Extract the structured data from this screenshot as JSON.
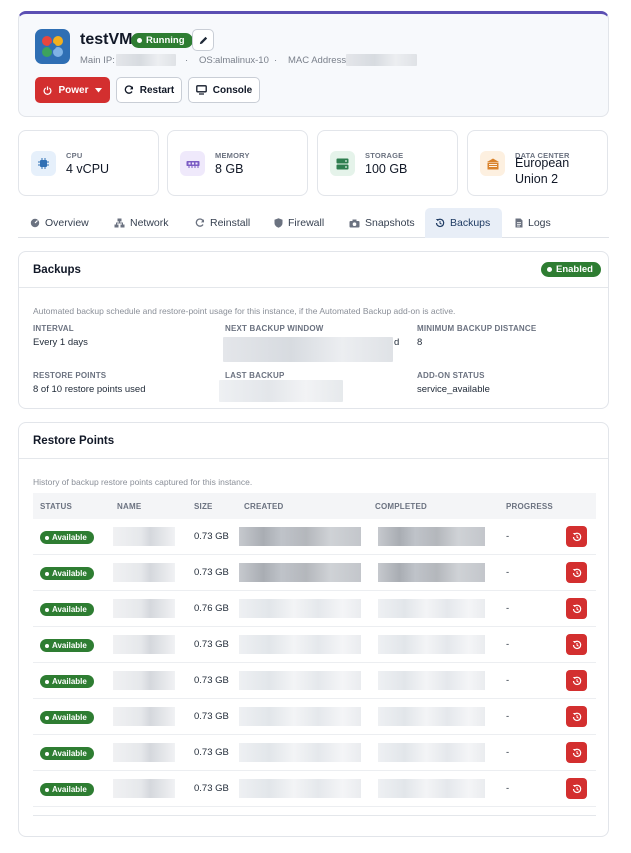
{
  "vm": {
    "name": "testVM",
    "status": "Running",
    "main_ip_label": "Main IP:",
    "os_label": "OS:",
    "os_value": "almalinux-10",
    "mac_label": "MAC Address:",
    "separator": "·"
  },
  "actions": {
    "power": "Power",
    "restart": "Restart",
    "console": "Console"
  },
  "stats": [
    {
      "label": "CPU",
      "value": "4 vCPU",
      "icon": "cpu-icon",
      "color": "#e6f0fb"
    },
    {
      "label": "MEMORY",
      "value": "8 GB",
      "icon": "memory-icon",
      "color": "#efe9fb"
    },
    {
      "label": "STORAGE",
      "value": "100 GB",
      "icon": "storage-icon",
      "color": "#e5f3ea"
    },
    {
      "label": "DATA CENTER",
      "value": "European Union 2",
      "icon": "datacenter-icon",
      "color": "#fdf0e0"
    }
  ],
  "tabs": [
    {
      "label": "Overview",
      "icon": "overview-icon"
    },
    {
      "label": "Network",
      "icon": "network-icon"
    },
    {
      "label": "Reinstall",
      "icon": "reinstall-icon"
    },
    {
      "label": "Firewall",
      "icon": "shield-icon"
    },
    {
      "label": "Snapshots",
      "icon": "camera-icon"
    },
    {
      "label": "Backups",
      "icon": "history-icon",
      "active": true
    },
    {
      "label": "Logs",
      "icon": "document-icon"
    }
  ],
  "backups": {
    "title": "Backups",
    "badge": "Enabled",
    "description": "Automated backup schedule and restore-point usage for this instance, if the Automated Backup add-on is active.",
    "fields": {
      "interval_label": "INTERVAL",
      "interval_value": "Every 1 days",
      "next_label": "NEXT BACKUP WINDOW",
      "next_suffix": "d",
      "min_label": "MINIMUM BACKUP DISTANCE",
      "min_value": "8",
      "restore_label": "RESTORE POINTS",
      "restore_value": "8 of 10 restore points used",
      "last_label": "LAST BACKUP",
      "addon_label": "ADD-ON STATUS",
      "addon_value": "service_available"
    }
  },
  "restore_points": {
    "title": "Restore Points",
    "description": "History of backup restore points captured for this instance.",
    "columns": [
      "STATUS",
      "NAME",
      "SIZE",
      "CREATED",
      "COMPLETED",
      "PROGRESS"
    ],
    "rows": [
      {
        "status": "Available",
        "size": "0.73 GB",
        "progress": "-"
      },
      {
        "status": "Available",
        "size": "0.73 GB",
        "progress": "-"
      },
      {
        "status": "Available",
        "size": "0.76 GB",
        "progress": "-"
      },
      {
        "status": "Available",
        "size": "0.73 GB",
        "progress": "-"
      },
      {
        "status": "Available",
        "size": "0.73 GB",
        "progress": "-"
      },
      {
        "status": "Available",
        "size": "0.73 GB",
        "progress": "-"
      },
      {
        "status": "Available",
        "size": "0.73 GB",
        "progress": "-"
      },
      {
        "status": "Available",
        "size": "0.73 GB",
        "progress": "-"
      }
    ]
  }
}
